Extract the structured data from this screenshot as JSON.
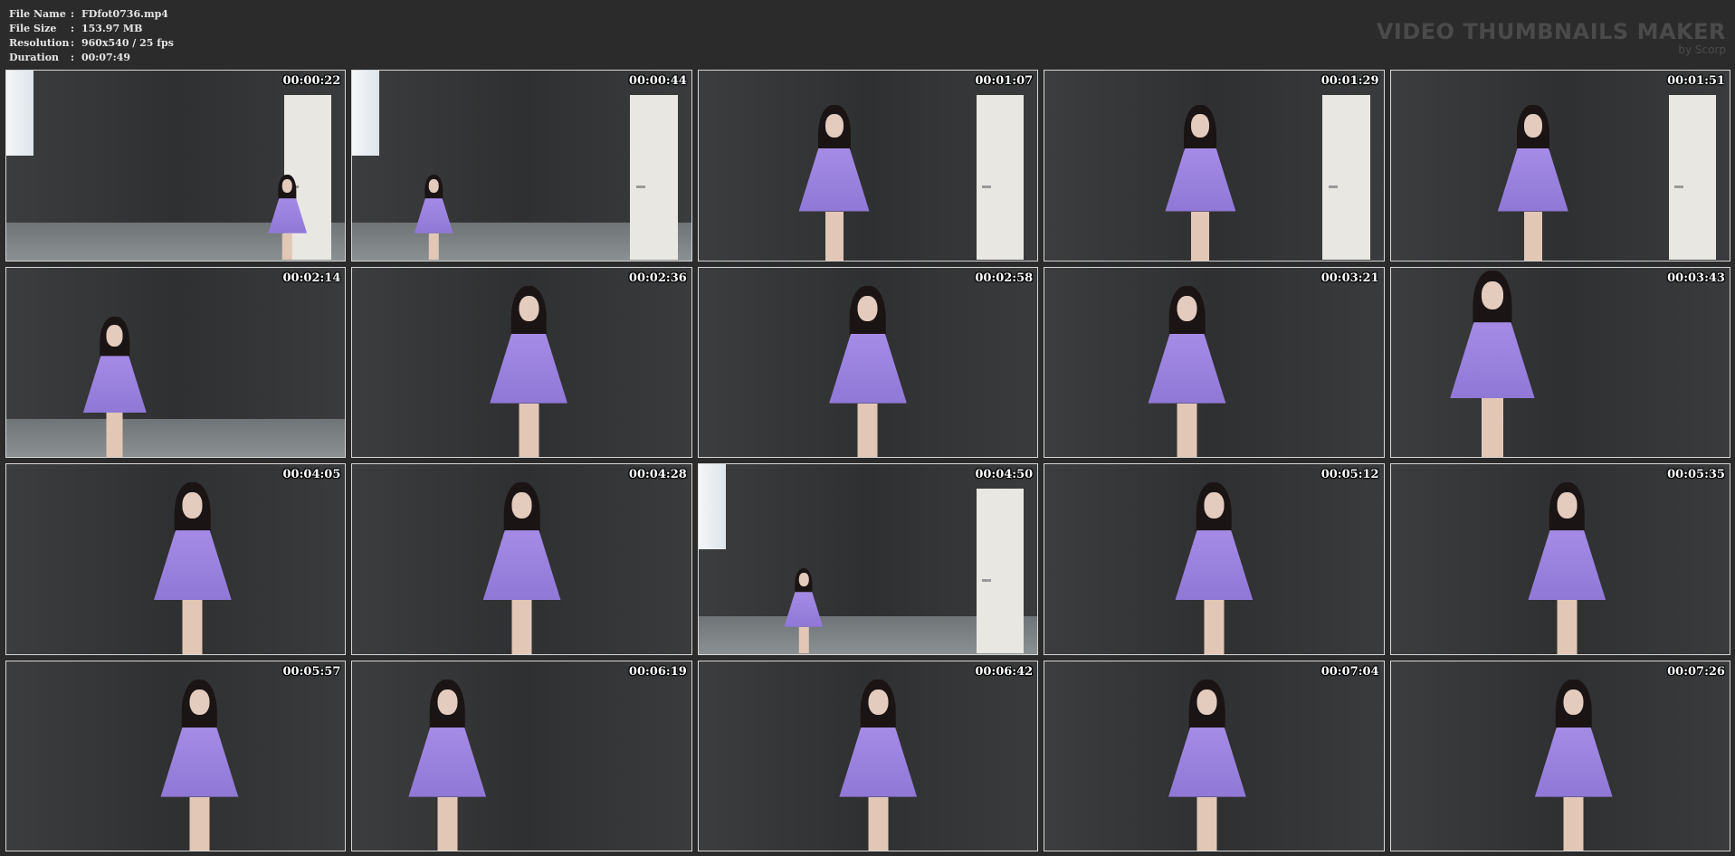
{
  "meta": [
    {
      "key": "File Name",
      "value": "FDfot0736.mp4"
    },
    {
      "key": "File Size",
      "value": "153.97 MB"
    },
    {
      "key": "Resolution",
      "value": "960x540 / 25 fps"
    },
    {
      "key": "Duration",
      "value": "00:07:49"
    }
  ],
  "separator": ":",
  "brand": {
    "title": "VIDEO THUMBNAILS MAKER",
    "sub": "by Scorp"
  },
  "thumbnails": [
    {
      "time": "00:00:22"
    },
    {
      "time": "00:00:44"
    },
    {
      "time": "00:01:07"
    },
    {
      "time": "00:01:29"
    },
    {
      "time": "00:01:51"
    },
    {
      "time": "00:02:14"
    },
    {
      "time": "00:02:36"
    },
    {
      "time": "00:02:58"
    },
    {
      "time": "00:03:21"
    },
    {
      "time": "00:03:43"
    },
    {
      "time": "00:04:05"
    },
    {
      "time": "00:04:28"
    },
    {
      "time": "00:04:50"
    },
    {
      "time": "00:05:12"
    },
    {
      "time": "00:05:35"
    },
    {
      "time": "00:05:57"
    },
    {
      "time": "00:06:19"
    },
    {
      "time": "00:06:42"
    },
    {
      "time": "00:07:04"
    },
    {
      "time": "00:07:26"
    }
  ]
}
